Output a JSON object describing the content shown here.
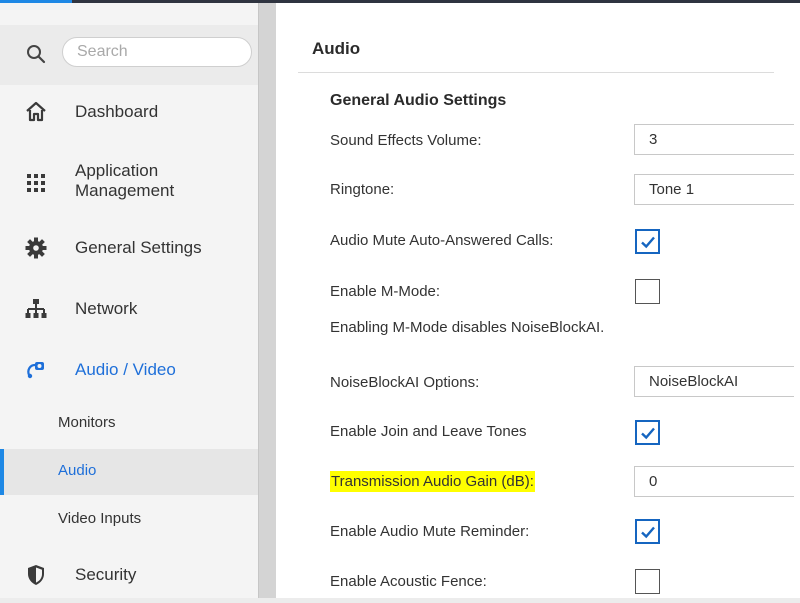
{
  "search": {
    "placeholder": "Search"
  },
  "nav": {
    "dashboard": "Dashboard",
    "application_management_line1": "Application",
    "application_management_line2": "Management",
    "general_settings": "General Settings",
    "network": "Network",
    "audio_video": "Audio / Video",
    "sub_monitors": "Monitors",
    "sub_audio": "Audio",
    "sub_video_inputs": "Video Inputs",
    "security": "Security"
  },
  "page": {
    "title": "Audio",
    "section_title": "General Audio Settings"
  },
  "settings": {
    "sound_effects_volume": {
      "label": "Sound Effects Volume:",
      "value": "3"
    },
    "ringtone": {
      "label": "Ringtone:",
      "value": "Tone 1"
    },
    "audio_mute_auto_answered": {
      "label": "Audio Mute Auto-Answered Calls:",
      "checked": true
    },
    "enable_m_mode": {
      "label": "Enable M-Mode:",
      "checked": false
    },
    "m_mode_note": "Enabling M-Mode disables NoiseBlockAI.",
    "noiseblock_options": {
      "label": "NoiseBlockAI Options:",
      "value": "NoiseBlockAI"
    },
    "join_leave_tones": {
      "label": "Enable Join and Leave Tones",
      "checked": true
    },
    "transmission_gain": {
      "label": "Transmission Audio Gain (dB):",
      "value": "0"
    },
    "mute_reminder": {
      "label": "Enable Audio Mute Reminder:",
      "checked": true
    },
    "acoustic_fence": {
      "label": "Enable Acoustic Fence:",
      "checked": false
    }
  },
  "colors": {
    "accent": "#1e88e5",
    "active_text": "#1e6fd9",
    "highlight": "#ffff00",
    "checkbox_checked": "#1565c0"
  }
}
